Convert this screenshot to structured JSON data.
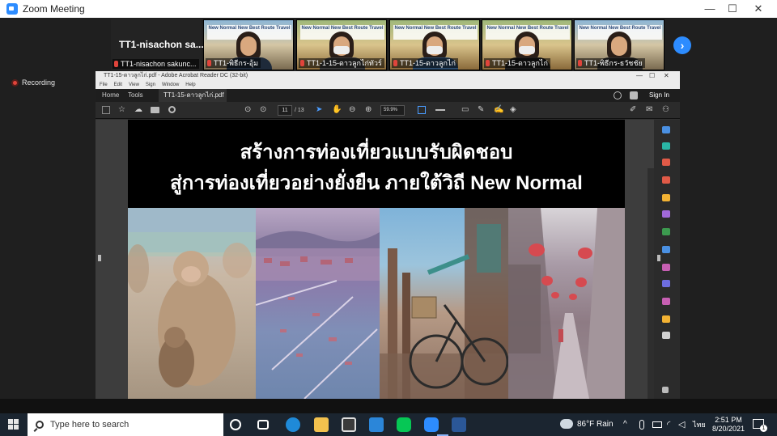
{
  "zoom": {
    "window_title": "Zoom Meeting",
    "win_min": "—",
    "win_max": "☐",
    "win_close": "✕",
    "recording_label": "Recording",
    "next_arrow": "›",
    "name_tile": {
      "display_name": "TT1-nisachon sa...",
      "caption": "TT1-nisachon sakunc..."
    },
    "participants": [
      {
        "caption": "TT1-พิธีกร-อุ้ม",
        "banner": "New Normal New Best Route Travel"
      },
      {
        "caption": "TT1-1-15-ดาวลูกไก่ทัวร์",
        "banner": "New Normal New Best Route Travel"
      },
      {
        "caption": "TT1-15-ดาวลูกไก่",
        "banner": "New Normal New Best Route Travel"
      },
      {
        "caption": "TT1-15-ดาวลูกไก่",
        "banner": "New Normal New Best Route Travel"
      },
      {
        "caption": "TT1-พิธีกร-ธวัชชัย",
        "banner": "New Normal New Best Route Travel"
      }
    ]
  },
  "acrobat": {
    "window_title": "TT1-15-ดาวลูกไก่.pdf - Adobe Acrobat Reader DC (32-bit)",
    "menu": [
      "File",
      "Edit",
      "View",
      "Sign",
      "Window",
      "Help"
    ],
    "tabs": {
      "home": "Home",
      "tools": "Tools",
      "document": "TT1-15-ดาวลูกไก่.pdf"
    },
    "tab_close": "×",
    "sign_in": "Sign In",
    "page_current": "11",
    "page_total": "/ 13",
    "zoom_level": "59.9%",
    "slide": {
      "line1": "สร้างการท่องเที่ยวแบบรับผิดชอบ",
      "line2": "สู่การท่องเที่ยวอย่างยั่งยืน ภายใต้วิถี New Normal"
    },
    "right_icons": [
      "zoom-icon",
      "export-pdf-icon",
      "organize-pages-icon",
      "create-pdf-icon",
      "comment-icon",
      "edit-icon",
      "excel-icon",
      "compress-icon",
      "fill-sign-icon",
      "protect-icon",
      "more-tools-icon",
      "print-production-icon",
      "scan-icon"
    ],
    "icon_colors": [
      "#4a90e2",
      "#2ab5a5",
      "#e05a47",
      "#e05a47",
      "#f2b233",
      "#a169d9",
      "#3c9a4f",
      "#4a90e2",
      "#c75fb3",
      "#6d6de0",
      "#c75fb3",
      "#f2b233",
      "#d0d0d0"
    ]
  },
  "taskbar": {
    "search_placeholder": "Type here to search",
    "weather": "86°F  Rain",
    "time": "2:51 PM",
    "date": "8/20/2021",
    "lang": "ไทย",
    "notification_count": "1"
  }
}
